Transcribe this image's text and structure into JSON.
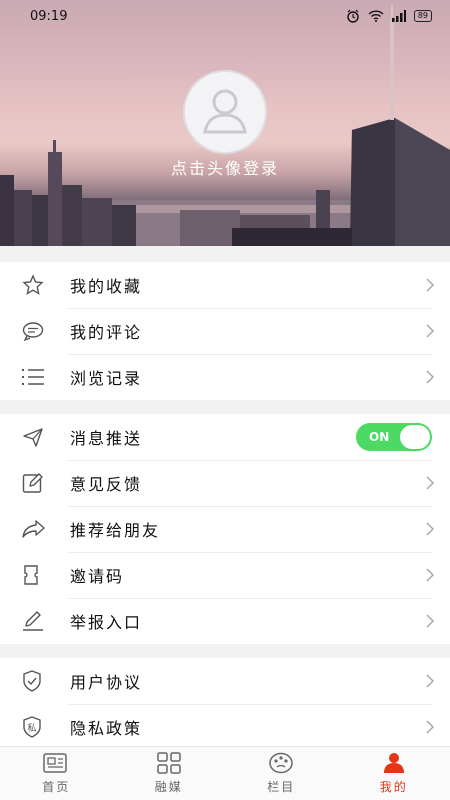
{
  "status": {
    "time": "09:19",
    "battery": "89"
  },
  "profile": {
    "login_prompt": "点击头像登录"
  },
  "groups": [
    [
      {
        "label": "我的收藏",
        "icon": "star-icon"
      },
      {
        "label": "我的评论",
        "icon": "comment-icon"
      },
      {
        "label": "浏览记录",
        "icon": "list-icon"
      }
    ],
    [
      {
        "label": "消息推送",
        "icon": "send-icon",
        "toggle": "ON"
      },
      {
        "label": "意见反馈",
        "icon": "edit-icon"
      },
      {
        "label": "推荐给朋友",
        "icon": "share-icon"
      },
      {
        "label": "邀请码",
        "icon": "ticket-icon"
      },
      {
        "label": "举报入口",
        "icon": "pencil-icon"
      }
    ],
    [
      {
        "label": "用户协议",
        "icon": "shield-icon"
      },
      {
        "label": "隐私政策",
        "icon": "privacy-icon",
        "icon_text": "私"
      }
    ]
  ],
  "tabbar": {
    "items": [
      {
        "label": "首页",
        "icon": "news-icon"
      },
      {
        "label": "融媒",
        "icon": "grid-icon"
      },
      {
        "label": "栏目",
        "icon": "palette-icon"
      },
      {
        "label": "我的",
        "icon": "user-icon",
        "active": true
      }
    ]
  },
  "colors": {
    "accent": "#e53517",
    "toggle_on": "#4cd964"
  }
}
